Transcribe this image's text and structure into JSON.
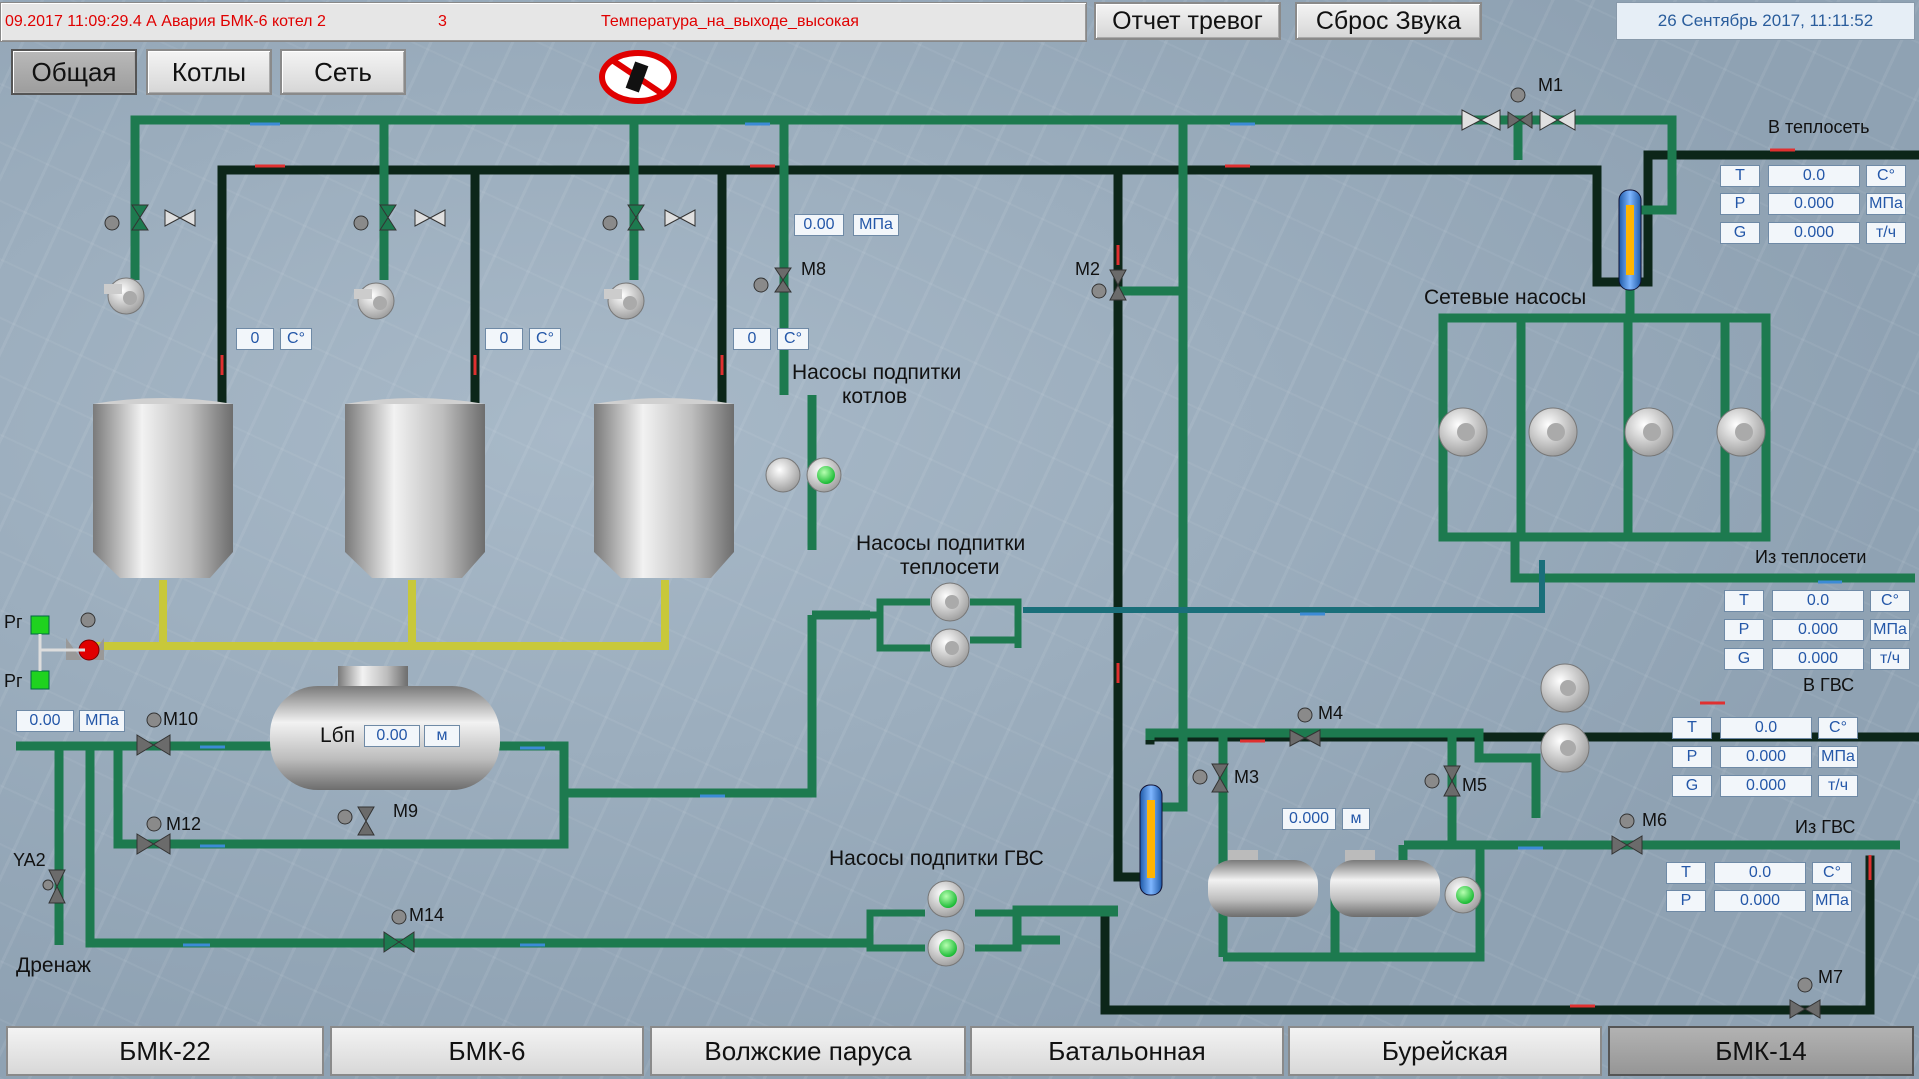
{
  "header": {
    "alarm_datetime": "09.2017 11:09:29.4 А Авария БМК-6 котел 2",
    "alarm_code": "3",
    "alarm_message": "Температура_на_выходе_высокая",
    "report_button": "Отчет тревог",
    "reset_sound_button": "Сброс Звука",
    "datetime": "26 Сентябрь 2017, 11:11:52"
  },
  "view_tabs": [
    {
      "label": "Общая",
      "active": true
    },
    {
      "label": "Котлы",
      "active": false
    },
    {
      "label": "Сеть",
      "active": false
    }
  ],
  "boilers": [
    {
      "temp": "0",
      "unit": "C°"
    },
    {
      "temp": "0",
      "unit": "C°"
    },
    {
      "temp": "0",
      "unit": "C°"
    }
  ],
  "boiler_feed": {
    "pressure": "0.00",
    "pressure_unit": "МПа",
    "temp": "0",
    "temp_unit": "C°"
  },
  "labels": {
    "boiler_feed_pumps_1": "Насосы подпитки",
    "boiler_feed_pumps_2": "котлов",
    "network_feed_pumps_1": "Насосы подпитки",
    "network_feed_pumps_2": "теплосети",
    "network_pumps": "Сетевые насосы",
    "gvs_feed_pumps": "Насосы подпитки ГВС",
    "to_network": "В теплосеть",
    "from_network": "Из теплосети",
    "to_gvs": "В ГВС",
    "from_gvs": "Из ГВС",
    "drain": "Дренаж",
    "rg_top": "Рг",
    "rg_bottom": "Рг",
    "ya2": "YA2",
    "tank_level_label": "Lбп",
    "tank_level": "0.00",
    "tank_level_unit": "м",
    "inlet_pressure": "0.00",
    "inlet_pressure_unit": "МПа",
    "gvs_tank_level": "0.000",
    "gvs_tank_level_unit": "м"
  },
  "valves": {
    "m1": "M1",
    "m2": "M2",
    "m3": "M3",
    "m4": "M4",
    "m5": "M5",
    "m6": "M6",
    "m7": "M7",
    "m8": "M8",
    "m9": "M9",
    "m10": "M10",
    "m12": "M12",
    "m14": "M14"
  },
  "to_network_table": [
    {
      "param": "T",
      "value": "0.0",
      "unit": "C°"
    },
    {
      "param": "P",
      "value": "0.000",
      "unit": "МПа"
    },
    {
      "param": "G",
      "value": "0.000",
      "unit": "т/ч"
    }
  ],
  "from_network_table": [
    {
      "param": "T",
      "value": "0.0",
      "unit": "C°"
    },
    {
      "param": "P",
      "value": "0.000",
      "unit": "МПа"
    },
    {
      "param": "G",
      "value": "0.000",
      "unit": "т/ч"
    }
  ],
  "to_gvs_table": [
    {
      "param": "T",
      "value": "0.0",
      "unit": "C°"
    },
    {
      "param": "P",
      "value": "0.000",
      "unit": "МПа"
    },
    {
      "param": "G",
      "value": "0.000",
      "unit": "т/ч"
    }
  ],
  "from_gvs_table": [
    {
      "param": "T",
      "value": "0.0",
      "unit": "C°"
    },
    {
      "param": "P",
      "value": "0.000",
      "unit": "МПа"
    }
  ],
  "station_tabs": [
    {
      "label": "БМК-22",
      "active": false
    },
    {
      "label": "БМК-6",
      "active": false
    },
    {
      "label": "Волжские паруса",
      "active": false
    },
    {
      "label": "Батальонная",
      "active": false
    },
    {
      "label": "Бурейская",
      "active": false
    },
    {
      "label": "БМК-14",
      "active": true
    }
  ],
  "colors": {
    "pipe_green": "#1d7a4f",
    "pipe_dark": "#0c2619",
    "pipe_teal": "#1a6f7a",
    "pipe_yellow": "#c8c83a",
    "alarm_red": "#e00000",
    "value_blue": "#2457a8"
  }
}
